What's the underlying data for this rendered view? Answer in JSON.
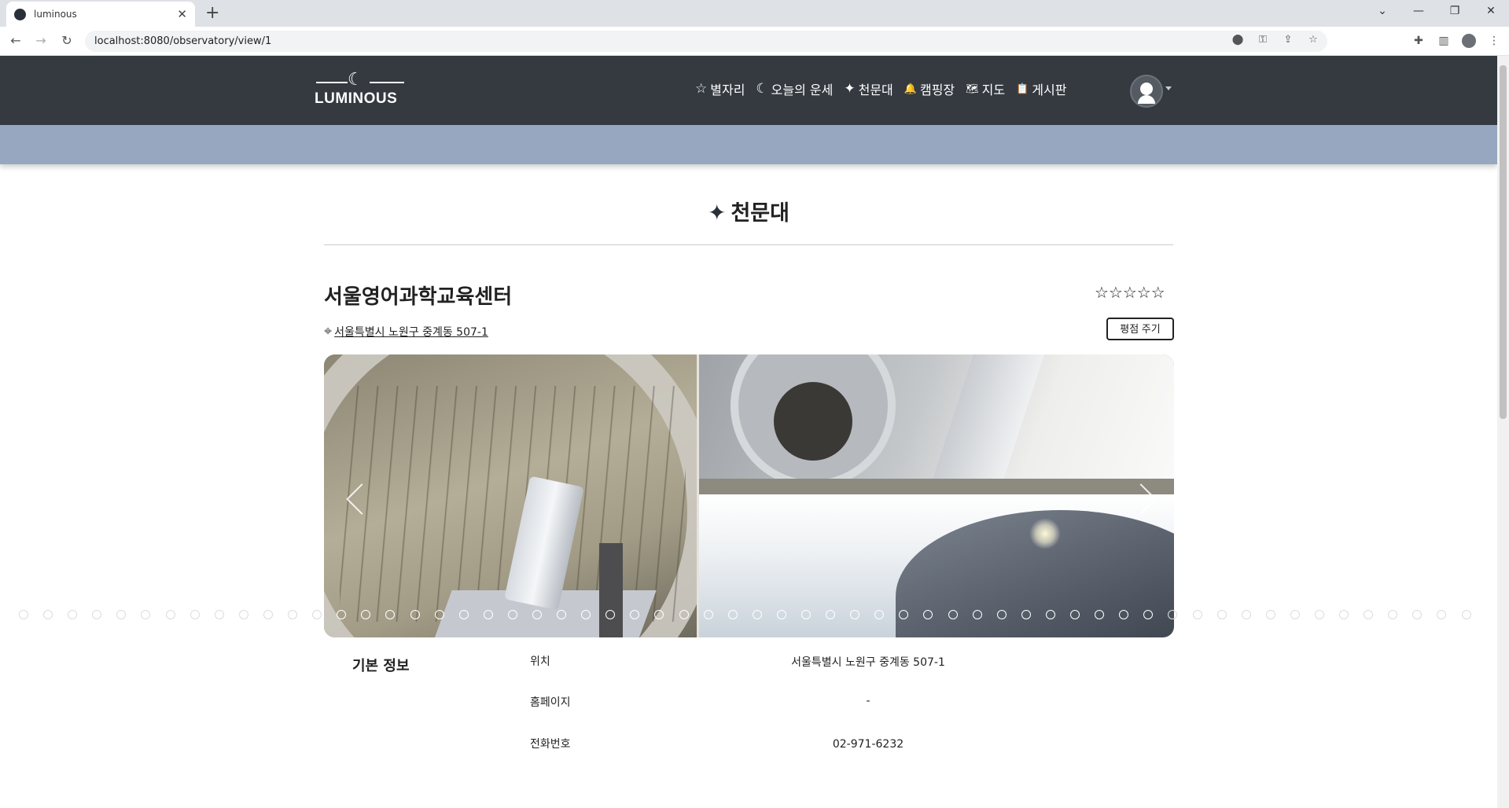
{
  "browser": {
    "tab_title": "luminous",
    "tab_close": "✕",
    "new_tab": "+",
    "url": "localhost:8080/observatory/view/1",
    "window_controls": [
      "⌄",
      "—",
      "❐",
      "✕"
    ]
  },
  "site": {
    "logo_text": "LUMINOUS",
    "nav": [
      {
        "icon": "☆",
        "label": "별자리"
      },
      {
        "icon": "☾",
        "label": "오늘의 운세"
      },
      {
        "icon": "✦",
        "label": "천문대"
      },
      {
        "icon": "🔔",
        "label": "캠핑장"
      },
      {
        "icon": "🗺",
        "label": "지도"
      },
      {
        "icon": "📋",
        "label": "게시판"
      }
    ]
  },
  "page": {
    "title": "천문대",
    "observatory_name": "서울영어과학교육센터",
    "rating_stars": "☆☆☆☆☆",
    "address": "서울특별시 노원구 중계동 507-1",
    "rate_button": "평점 주기"
  },
  "carousel": {
    "total_slides": 60,
    "active_indices": [
      13,
      39
    ]
  },
  "basic_info": {
    "heading": "기본 정보",
    "rows": [
      {
        "label": "위치",
        "value": "서울특별시 노원구 중계동 507-1"
      },
      {
        "label": "홈페이지",
        "value": "-"
      },
      {
        "label": "전화번호",
        "value": "02-971-6232"
      }
    ]
  }
}
